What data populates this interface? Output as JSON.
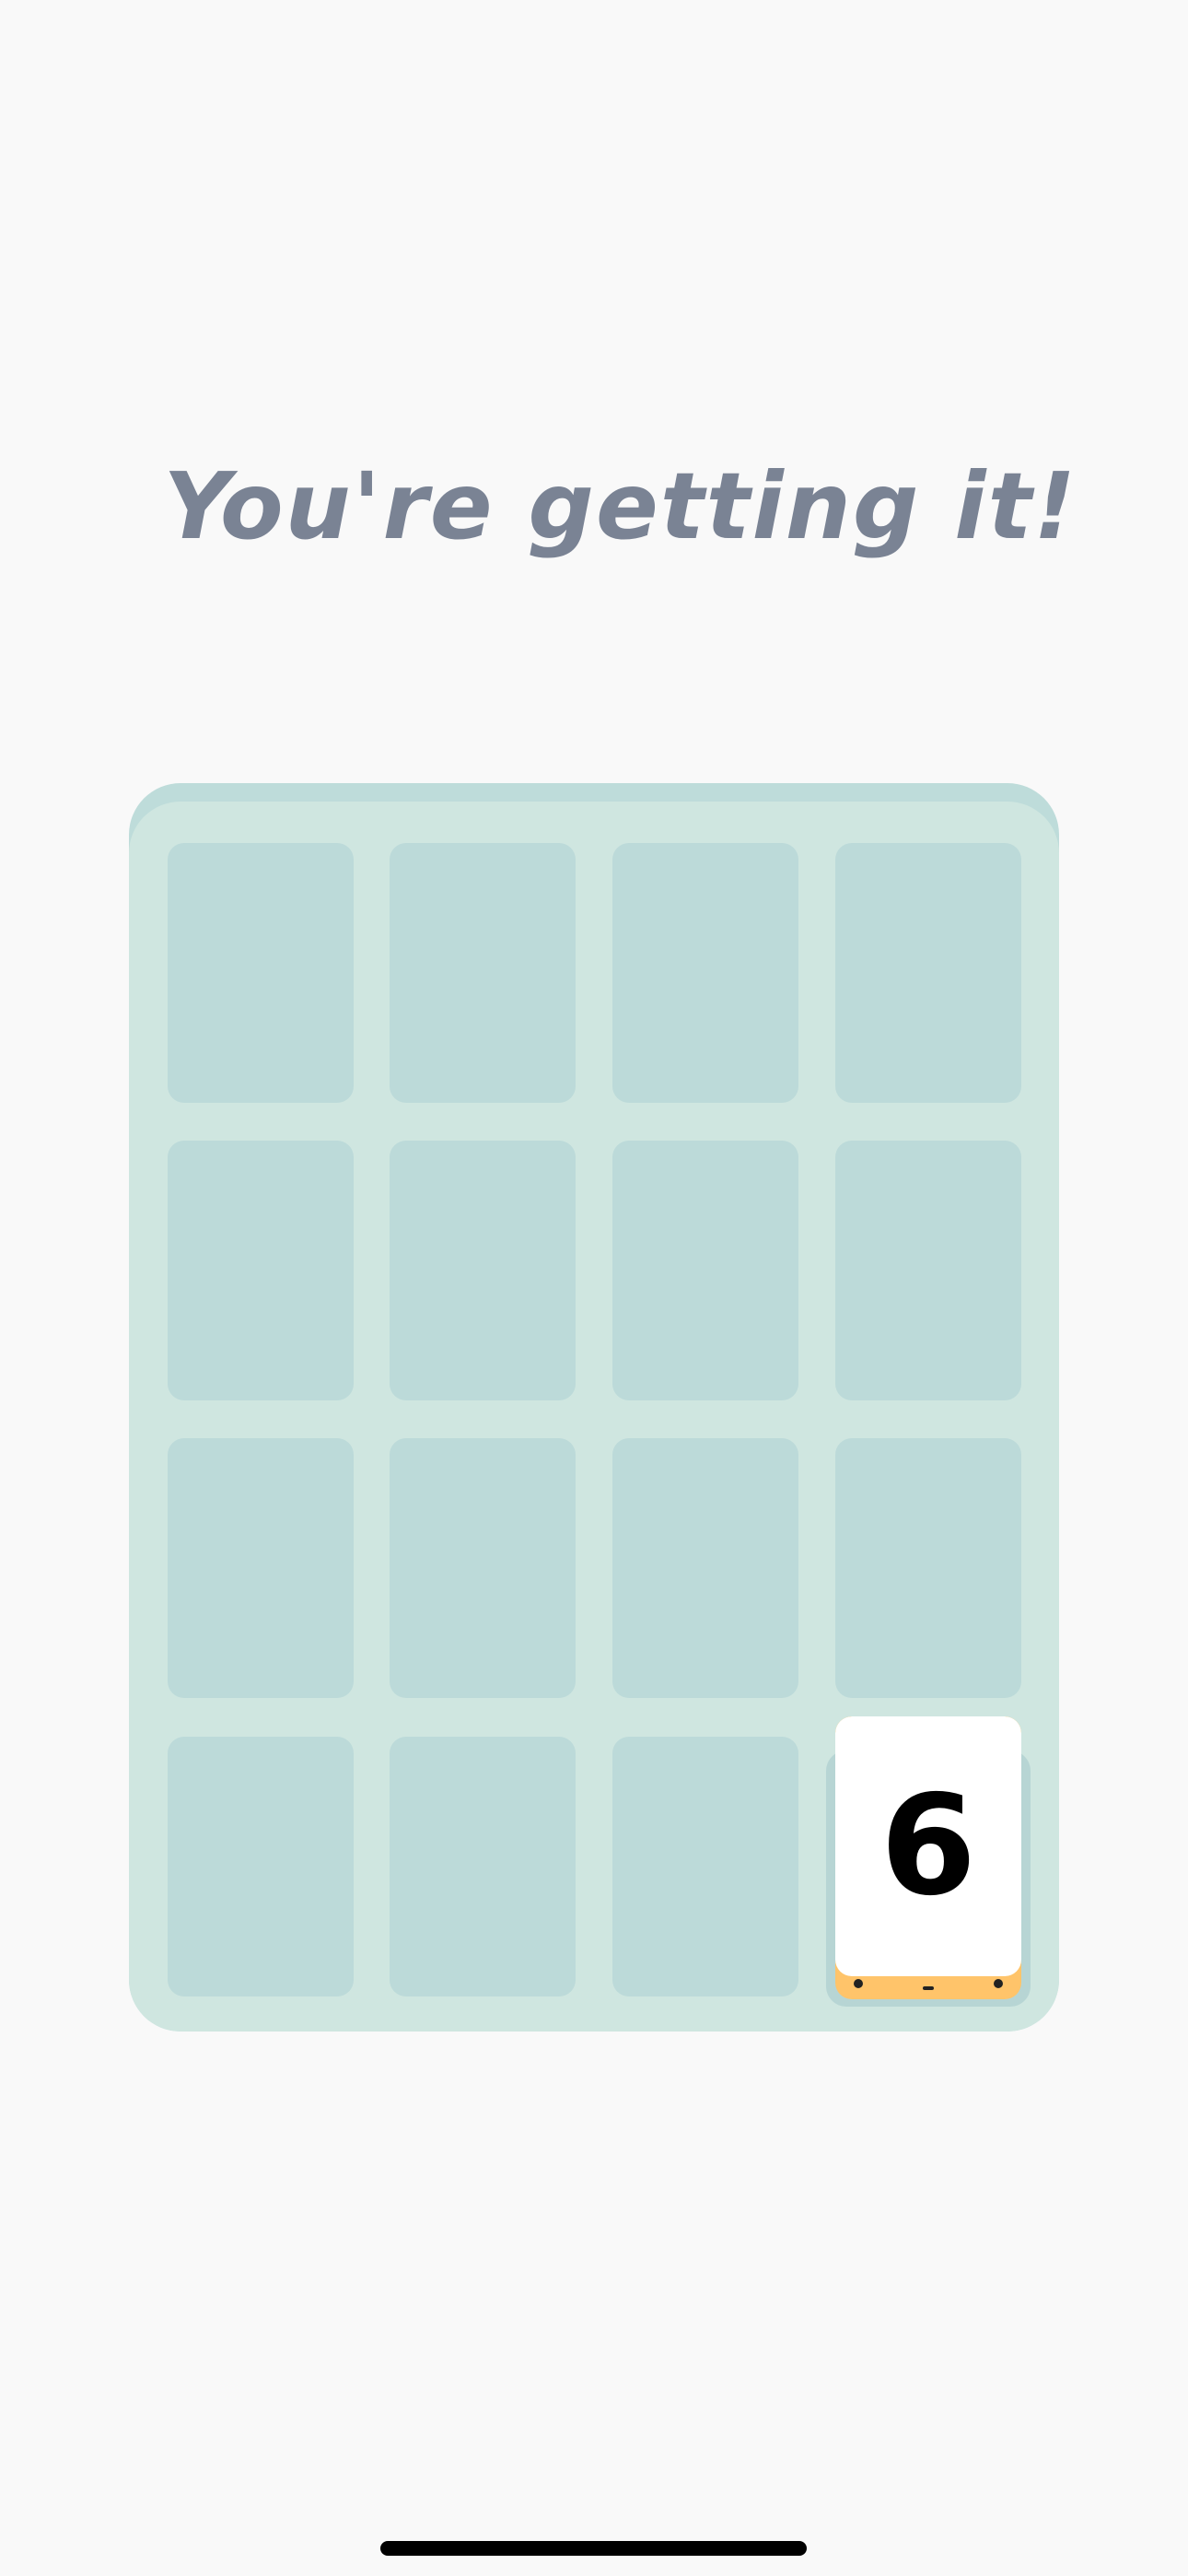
{
  "headline": "You're getting it!",
  "board": {
    "rows": 4,
    "columns": 4,
    "empty_slots": 15,
    "tiles": [
      {
        "value": "6",
        "row": 4,
        "column": 4,
        "color": "#ffc46a"
      }
    ]
  },
  "colors": {
    "background": "#f9f9f9",
    "board": "#cfe6e0",
    "slot": "#bcdad9",
    "headline": "#7a8394",
    "tile_face": "#ffffff",
    "tile_base": "#ffc46a"
  }
}
